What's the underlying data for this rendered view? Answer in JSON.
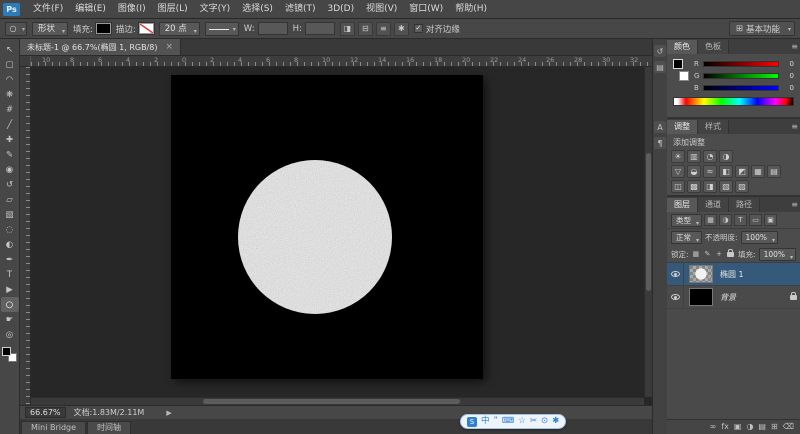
{
  "menubar": {
    "logo": "Ps",
    "items": [
      "文件(F)",
      "编辑(E)",
      "图像(I)",
      "图层(L)",
      "文字(Y)",
      "选择(S)",
      "滤镜(T)",
      "3D(D)",
      "视图(V)",
      "窗口(W)",
      "帮助(H)"
    ]
  },
  "options": {
    "tool_mode": "形状",
    "fill_label": "填充:",
    "stroke_label": "描边:",
    "stroke_size": "20 点",
    "w_label": "W:",
    "h_label": "H:",
    "check_glyph": "✓",
    "align_edges_label": "对齐边缘",
    "workspace_icon": "⊞",
    "workspace": "基本功能",
    "path_buttons": [
      {
        "name": "path-operations",
        "glyph": "◨"
      },
      {
        "name": "path-alignment",
        "glyph": "⊟"
      },
      {
        "name": "path-arrangement",
        "glyph": "≡"
      },
      {
        "name": "shape-settings",
        "glyph": "✱"
      }
    ]
  },
  "toolbar": {
    "tools": [
      {
        "name": "move",
        "glyph": "↖"
      },
      {
        "name": "rectangular-marquee",
        "glyph": "▢"
      },
      {
        "name": "lasso",
        "glyph": "◠"
      },
      {
        "name": "quick-selection",
        "glyph": "❋"
      },
      {
        "name": "crop",
        "glyph": "#"
      },
      {
        "name": "eyedropper",
        "glyph": "╱"
      },
      {
        "name": "healing-brush",
        "glyph": "✚"
      },
      {
        "name": "brush",
        "glyph": "✎"
      },
      {
        "name": "clone-stamp",
        "glyph": "◉"
      },
      {
        "name": "history-brush",
        "glyph": "↺"
      },
      {
        "name": "eraser",
        "glyph": "▱"
      },
      {
        "name": "gradient",
        "glyph": "▧"
      },
      {
        "name": "blur",
        "glyph": "◌"
      },
      {
        "name": "dodge",
        "glyph": "◐"
      },
      {
        "name": "pen",
        "glyph": "✒"
      },
      {
        "name": "type",
        "glyph": "T"
      },
      {
        "name": "path-selection",
        "glyph": "▶"
      },
      {
        "name": "ellipse-shape",
        "glyph": "○"
      },
      {
        "name": "hand",
        "glyph": "☛"
      },
      {
        "name": "zoom",
        "glyph": "◎"
      }
    ]
  },
  "document": {
    "tab_title": "未标题-1 @ 66.7%(椭圆 1, RGB/8)",
    "close_glyph": "×"
  },
  "ruler": {
    "spacing_px": 28,
    "h_numbers": [
      "10",
      "8",
      "6",
      "4",
      "2",
      "0",
      "2",
      "4",
      "6",
      "8",
      "10",
      "12",
      "14",
      "16",
      "18",
      "20",
      "22",
      "24",
      "26",
      "28",
      "30",
      "32"
    ]
  },
  "canvas": {
    "background": "#000000",
    "shape": "noise-filled-circle",
    "shape_fill": "#e9e9e9"
  },
  "status": {
    "zoom": "66.67%",
    "doc_info": "文档:1.83M/2.11M",
    "arrow_glyph": "▶"
  },
  "collapsed_panels": [
    {
      "name": "history",
      "glyph": "↺"
    },
    {
      "name": "properties",
      "glyph": "▤"
    },
    {
      "name": "character",
      "glyph": "A"
    },
    {
      "name": "paragraph",
      "glyph": "¶"
    }
  ],
  "color_panel": {
    "tabs": [
      "颜色",
      "色板"
    ],
    "channels": [
      {
        "label": "R",
        "value": "0"
      },
      {
        "label": "G",
        "value": "0"
      },
      {
        "label": "B",
        "value": "0"
      }
    ]
  },
  "adjustments_panel": {
    "tabs": [
      "调整",
      "样式"
    ],
    "title": "添加调整",
    "icons": [
      {
        "name": "brightness-contrast",
        "glyph": "☀"
      },
      {
        "name": "levels",
        "glyph": "▥"
      },
      {
        "name": "curves",
        "glyph": "◔"
      },
      {
        "name": "exposure",
        "glyph": "◑"
      },
      {
        "name": "vibrance",
        "glyph": "▽"
      },
      {
        "name": "hue-saturation",
        "glyph": "◒"
      },
      {
        "name": "color-balance",
        "glyph": "≈"
      },
      {
        "name": "black-white",
        "glyph": "◧"
      },
      {
        "name": "photo-filter",
        "glyph": "◩"
      },
      {
        "name": "channel-mixer",
        "glyph": "▦"
      },
      {
        "name": "color-lookup",
        "glyph": "▤"
      },
      {
        "name": "invert",
        "glyph": "◫"
      },
      {
        "name": "posterize",
        "glyph": "▩"
      },
      {
        "name": "threshold",
        "glyph": "◨"
      },
      {
        "name": "gradient-map",
        "glyph": "▧"
      },
      {
        "name": "selective-color",
        "glyph": "▨"
      }
    ]
  },
  "layers_panel": {
    "tabs": [
      "图层",
      "通道",
      "路径"
    ],
    "filter_label": "类型",
    "filter_icons": [
      {
        "name": "filter-pixel-layers",
        "glyph": "▦"
      },
      {
        "name": "filter-adjustment-layers",
        "glyph": "◑"
      },
      {
        "name": "filter-type-layers",
        "glyph": "T"
      },
      {
        "name": "filter-shape-layers",
        "glyph": "▭"
      },
      {
        "name": "filter-smart-objects",
        "glyph": "▣"
      }
    ],
    "blend_mode": "正常",
    "opacity_label": "不透明度:",
    "opacity_value": "100%",
    "lock_label": "锁定:",
    "lock_icons": [
      {
        "name": "lock-transparent-pixels",
        "glyph": "▦"
      },
      {
        "name": "lock-image-pixels",
        "glyph": "✎"
      },
      {
        "name": "lock-position",
        "glyph": "+"
      }
    ],
    "fill_label": "填充:",
    "fill_value": "100%",
    "layers": [
      {
        "name": "椭圆 1",
        "selected": true,
        "visible": true
      },
      {
        "name": "背景",
        "locked": true,
        "visible": true
      }
    ],
    "bottom_icons": [
      {
        "name": "link-layers",
        "glyph": "∞"
      },
      {
        "name": "layer-effects",
        "glyph": "fx"
      },
      {
        "name": "add-layer-mask",
        "glyph": "▣"
      },
      {
        "name": "new-adjustment-layer",
        "glyph": "◑"
      },
      {
        "name": "new-group",
        "glyph": "▤"
      },
      {
        "name": "new-layer",
        "glyph": "⊞"
      },
      {
        "name": "delete-layer",
        "glyph": "⌫"
      }
    ]
  },
  "bottom_tabs": [
    "Mini Bridge",
    "时间轴"
  ],
  "ime_bar": {
    "logo": "S",
    "items": [
      {
        "name": "ime-language-mode",
        "glyph": "中"
      },
      {
        "name": "ime-punctuation",
        "glyph": "”"
      },
      {
        "name": "ime-keyboard",
        "glyph": "⌨"
      },
      {
        "name": "ime-favorites",
        "glyph": "☆"
      },
      {
        "name": "ime-clip",
        "glyph": "✂"
      },
      {
        "name": "ime-search",
        "glyph": "⊙"
      },
      {
        "name": "ime-settings",
        "glyph": "✱"
      }
    ]
  },
  "colors": {
    "selected_layer": "#35597a",
    "canvas_area_bg": "#272727",
    "ime_accent": "#2f7fd3"
  }
}
